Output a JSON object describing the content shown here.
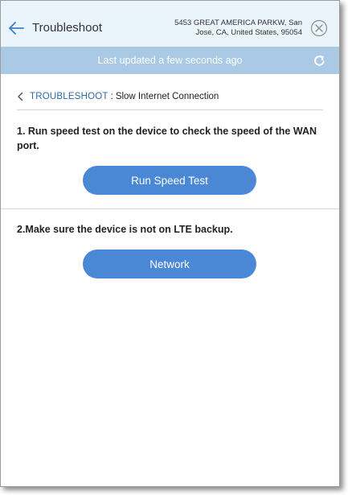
{
  "header": {
    "title": "Troubleshoot",
    "address": "5453 GREAT AMERICA PARKW, San Jose, CA, United States, 95054"
  },
  "status": {
    "text": "Last updated a few seconds ago"
  },
  "breadcrumb": {
    "parent": "TROUBLESHOOT",
    "separator": ":",
    "current": "Slow Internet Connection"
  },
  "steps": [
    {
      "text": "1. Run speed test on the device to check the speed of the WAN port.",
      "button_label": "Run Speed Test"
    },
    {
      "text": "2.Make sure the device is not on LTE backup.",
      "button_label": "Network"
    }
  ],
  "colors": {
    "header_bg": "#eaf4fb",
    "status_bar": "#a9c9e4",
    "link": "#2c6aa6",
    "button": "#4a88d6"
  },
  "icons": {
    "back": "arrow-left-icon",
    "close": "close-circle-icon",
    "refresh": "refresh-icon",
    "breadcrumb": "chevron-left-icon"
  }
}
